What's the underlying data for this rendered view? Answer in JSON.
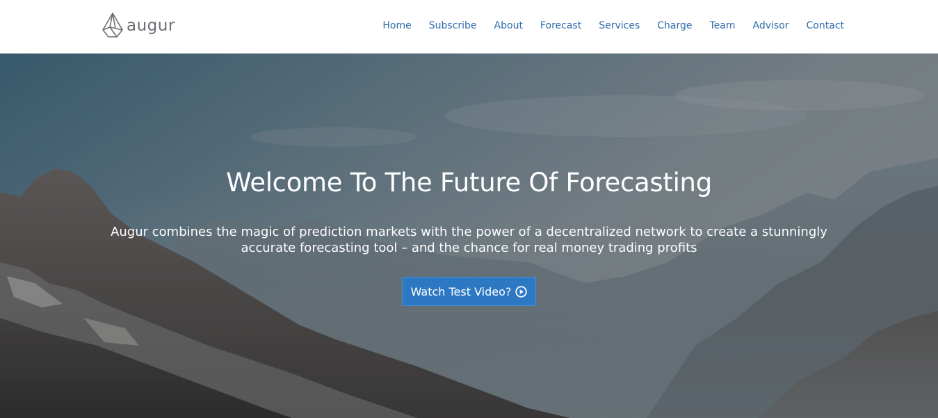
{
  "header": {
    "logo_text": "augur",
    "nav": [
      {
        "label": "Home"
      },
      {
        "label": "Subscribe"
      },
      {
        "label": "About"
      },
      {
        "label": "Forecast"
      },
      {
        "label": "Services"
      },
      {
        "label": "Charge"
      },
      {
        "label": "Team"
      },
      {
        "label": "Advisor"
      },
      {
        "label": "Contact"
      }
    ]
  },
  "hero": {
    "title": "Welcome To The Future Of Forecasting",
    "subtitle": "Augur combines the magic of prediction markets with the power of a decentralized network to create a stunningly accurate forecasting tool – and the chance for real money trading profits",
    "button_label": "Watch Test Video?",
    "button_icon": "play-circle-icon"
  },
  "colors": {
    "nav_link": "#2d6aa8",
    "button_bg": "#2d78c2",
    "header_bg": "#ffffff"
  }
}
